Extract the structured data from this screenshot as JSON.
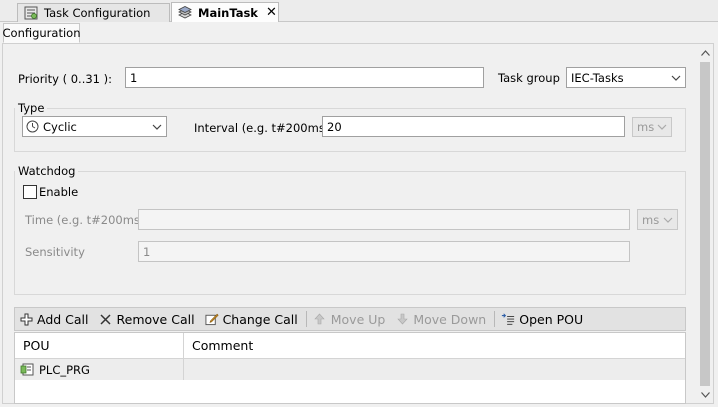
{
  "doc_tabs": [
    {
      "label": "Task Configuration",
      "icon": "task-configuration-icon",
      "active": false
    },
    {
      "label": "MainTask",
      "icon": "task-icon",
      "active": true,
      "close": "✕"
    }
  ],
  "inner_tab": "Configuration",
  "priority": {
    "label": "Priority ( 0..31 ):",
    "value": "1"
  },
  "task_group": {
    "label": "Task group",
    "value": "IEC-Tasks"
  },
  "type_group": {
    "title": "Type",
    "type_value": "Cyclic",
    "type_icon": "clock-icon",
    "interval_label": "Interval (e.g. t#200ms)",
    "interval_value": "20",
    "interval_unit": "ms"
  },
  "watchdog": {
    "title": "Watchdog",
    "enable_label": "Enable",
    "enabled": false,
    "time_label": "Time (e.g. t#200ms)",
    "time_value": "",
    "time_unit": "ms",
    "sensitivity_label": "Sensitivity",
    "sensitivity_value": "1"
  },
  "toolbar": {
    "add_call": "Add Call",
    "remove_call": "Remove Call",
    "change_call": "Change Call",
    "move_up": "Move Up",
    "move_down": "Move Down",
    "open_pou": "Open POU"
  },
  "table": {
    "columns": [
      "POU",
      "Comment"
    ],
    "rows": [
      {
        "pou": "PLC_PRG",
        "comment": ""
      }
    ]
  },
  "colors": {
    "disabled_text": "#9a9a9a",
    "toolbar_bg": "#e2e2e2",
    "row_bg": "#ededed"
  }
}
